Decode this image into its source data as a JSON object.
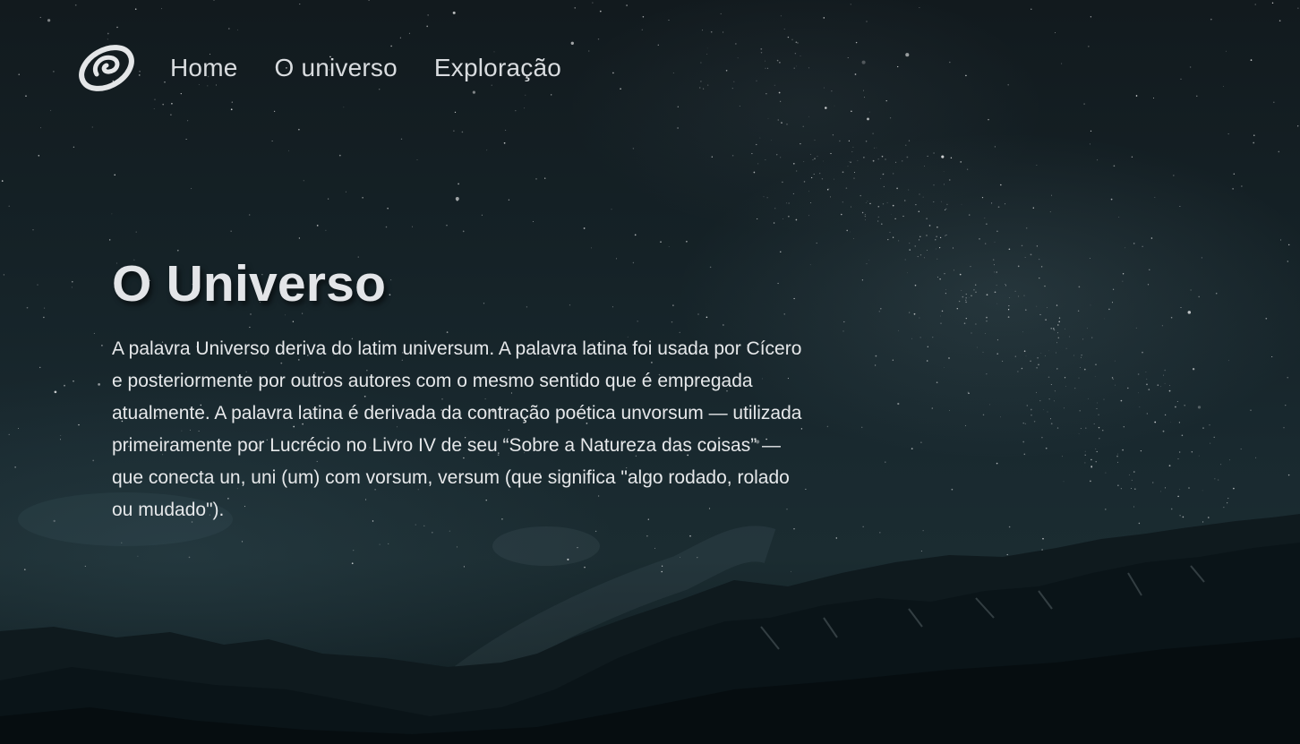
{
  "navbar": {
    "logo_icon": "spiral-galaxy-icon",
    "links": [
      {
        "label": "Home"
      },
      {
        "label": "O universo"
      },
      {
        "label": "Exploração"
      }
    ]
  },
  "hero": {
    "title": "O Universo",
    "paragraph": "A palavra Universo deriva do latim universum. A palavra latina foi usada por Cícero e posteriormente por outros autores com o mesmo sentido que é empregada atualmente. A palavra latina é derivada da contração poética unvorsum — utilizada primeiramente por Lucrécio no Livro IV de seu “Sobre a Natureza das coisas” — que conecta un, uni (um) com vorsum, versum (que significa \"algo rodado, rolado ou mudado\")."
  },
  "colors": {
    "text": "#e3e5e8",
    "nav_text": "#d9dcdf",
    "sky_dark": "#121a1e",
    "sky_teal": "#1b2c31"
  }
}
